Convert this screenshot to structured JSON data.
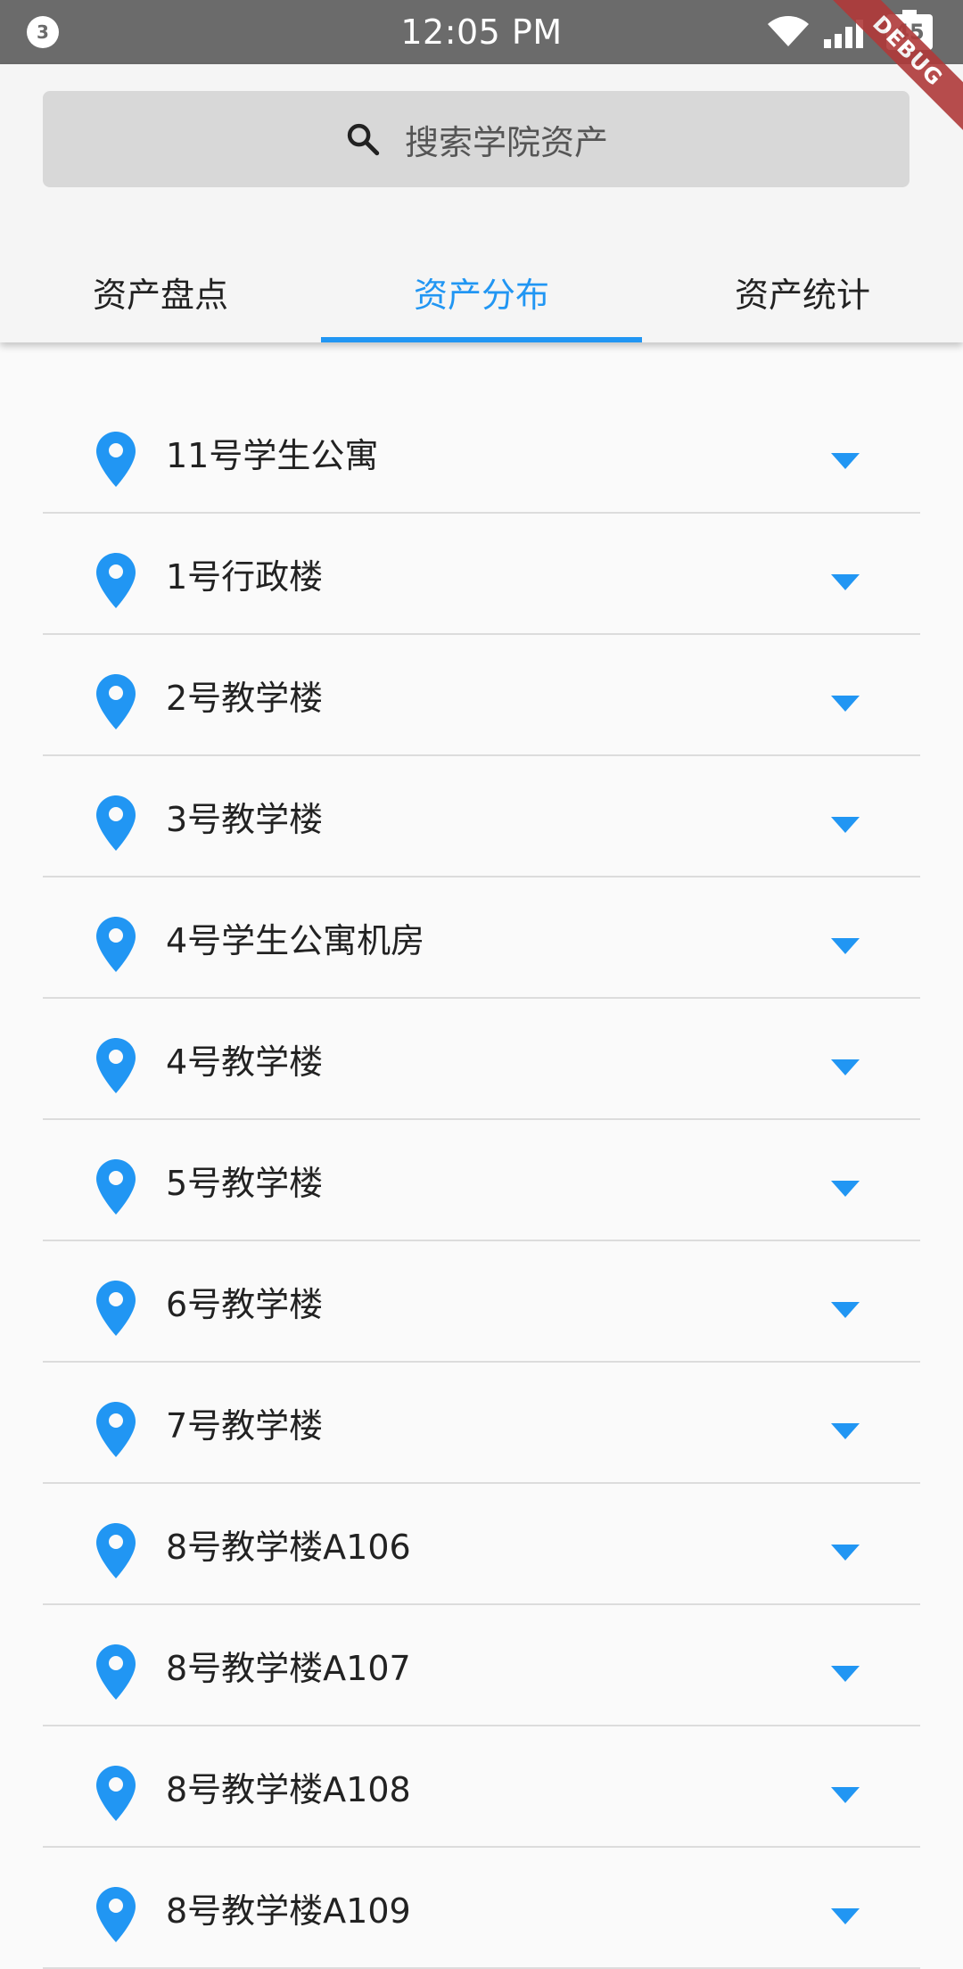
{
  "status_bar": {
    "notification_count": "3",
    "time": "12:05 PM",
    "battery": "45",
    "icons": [
      "wifi-icon",
      "cellular-signal-icon",
      "battery-icon"
    ]
  },
  "debug_banner": "DEBUG",
  "search": {
    "placeholder": "搜索学院资产",
    "icon": "search-icon"
  },
  "tabs": [
    {
      "label": "资产盘点",
      "active": false
    },
    {
      "label": "资产分布",
      "active": true
    },
    {
      "label": "资产统计",
      "active": false
    }
  ],
  "locations": [
    {
      "label": "11号学生公寓",
      "icon": "location-pin-icon"
    },
    {
      "label": "1号行政楼",
      "icon": "location-pin-icon"
    },
    {
      "label": "2号教学楼",
      "icon": "location-pin-icon"
    },
    {
      "label": "3号教学楼",
      "icon": "location-pin-icon"
    },
    {
      "label": "4号学生公寓机房",
      "icon": "location-pin-icon"
    },
    {
      "label": "4号教学楼",
      "icon": "location-pin-icon"
    },
    {
      "label": "5号教学楼",
      "icon": "location-pin-icon"
    },
    {
      "label": "6号教学楼",
      "icon": "location-pin-icon"
    },
    {
      "label": "7号教学楼",
      "icon": "location-pin-icon"
    },
    {
      "label": "8号教学楼A106",
      "icon": "location-pin-icon"
    },
    {
      "label": "8号教学楼A107",
      "icon": "location-pin-icon"
    },
    {
      "label": "8号教学楼A108",
      "icon": "location-pin-icon"
    },
    {
      "label": "8号教学楼A109",
      "icon": "location-pin-icon"
    }
  ],
  "colors": {
    "accent": "#2196f3",
    "status_bar": "#6b6b6b",
    "header_bg": "#f5f5f5",
    "search_bg": "#d8d8d8",
    "page_bg": "#fafafa",
    "debug_ribbon": "#b03a3a"
  }
}
